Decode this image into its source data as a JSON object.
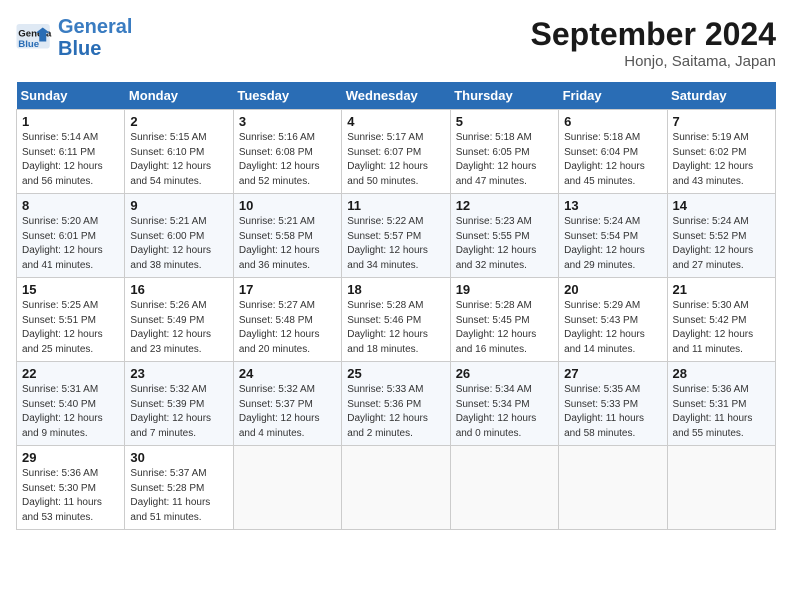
{
  "header": {
    "logo_line1": "General",
    "logo_line2": "Blue",
    "month_title": "September 2024",
    "location": "Honjo, Saitama, Japan"
  },
  "days_of_week": [
    "Sunday",
    "Monday",
    "Tuesday",
    "Wednesday",
    "Thursday",
    "Friday",
    "Saturday"
  ],
  "weeks": [
    [
      {
        "day": "1",
        "info": "Sunrise: 5:14 AM\nSunset: 6:11 PM\nDaylight: 12 hours\nand 56 minutes."
      },
      {
        "day": "2",
        "info": "Sunrise: 5:15 AM\nSunset: 6:10 PM\nDaylight: 12 hours\nand 54 minutes."
      },
      {
        "day": "3",
        "info": "Sunrise: 5:16 AM\nSunset: 6:08 PM\nDaylight: 12 hours\nand 52 minutes."
      },
      {
        "day": "4",
        "info": "Sunrise: 5:17 AM\nSunset: 6:07 PM\nDaylight: 12 hours\nand 50 minutes."
      },
      {
        "day": "5",
        "info": "Sunrise: 5:18 AM\nSunset: 6:05 PM\nDaylight: 12 hours\nand 47 minutes."
      },
      {
        "day": "6",
        "info": "Sunrise: 5:18 AM\nSunset: 6:04 PM\nDaylight: 12 hours\nand 45 minutes."
      },
      {
        "day": "7",
        "info": "Sunrise: 5:19 AM\nSunset: 6:02 PM\nDaylight: 12 hours\nand 43 minutes."
      }
    ],
    [
      {
        "day": "8",
        "info": "Sunrise: 5:20 AM\nSunset: 6:01 PM\nDaylight: 12 hours\nand 41 minutes."
      },
      {
        "day": "9",
        "info": "Sunrise: 5:21 AM\nSunset: 6:00 PM\nDaylight: 12 hours\nand 38 minutes."
      },
      {
        "day": "10",
        "info": "Sunrise: 5:21 AM\nSunset: 5:58 PM\nDaylight: 12 hours\nand 36 minutes."
      },
      {
        "day": "11",
        "info": "Sunrise: 5:22 AM\nSunset: 5:57 PM\nDaylight: 12 hours\nand 34 minutes."
      },
      {
        "day": "12",
        "info": "Sunrise: 5:23 AM\nSunset: 5:55 PM\nDaylight: 12 hours\nand 32 minutes."
      },
      {
        "day": "13",
        "info": "Sunrise: 5:24 AM\nSunset: 5:54 PM\nDaylight: 12 hours\nand 29 minutes."
      },
      {
        "day": "14",
        "info": "Sunrise: 5:24 AM\nSunset: 5:52 PM\nDaylight: 12 hours\nand 27 minutes."
      }
    ],
    [
      {
        "day": "15",
        "info": "Sunrise: 5:25 AM\nSunset: 5:51 PM\nDaylight: 12 hours\nand 25 minutes."
      },
      {
        "day": "16",
        "info": "Sunrise: 5:26 AM\nSunset: 5:49 PM\nDaylight: 12 hours\nand 23 minutes."
      },
      {
        "day": "17",
        "info": "Sunrise: 5:27 AM\nSunset: 5:48 PM\nDaylight: 12 hours\nand 20 minutes."
      },
      {
        "day": "18",
        "info": "Sunrise: 5:28 AM\nSunset: 5:46 PM\nDaylight: 12 hours\nand 18 minutes."
      },
      {
        "day": "19",
        "info": "Sunrise: 5:28 AM\nSunset: 5:45 PM\nDaylight: 12 hours\nand 16 minutes."
      },
      {
        "day": "20",
        "info": "Sunrise: 5:29 AM\nSunset: 5:43 PM\nDaylight: 12 hours\nand 14 minutes."
      },
      {
        "day": "21",
        "info": "Sunrise: 5:30 AM\nSunset: 5:42 PM\nDaylight: 12 hours\nand 11 minutes."
      }
    ],
    [
      {
        "day": "22",
        "info": "Sunrise: 5:31 AM\nSunset: 5:40 PM\nDaylight: 12 hours\nand 9 minutes."
      },
      {
        "day": "23",
        "info": "Sunrise: 5:32 AM\nSunset: 5:39 PM\nDaylight: 12 hours\nand 7 minutes."
      },
      {
        "day": "24",
        "info": "Sunrise: 5:32 AM\nSunset: 5:37 PM\nDaylight: 12 hours\nand 4 minutes."
      },
      {
        "day": "25",
        "info": "Sunrise: 5:33 AM\nSunset: 5:36 PM\nDaylight: 12 hours\nand 2 minutes."
      },
      {
        "day": "26",
        "info": "Sunrise: 5:34 AM\nSunset: 5:34 PM\nDaylight: 12 hours\nand 0 minutes."
      },
      {
        "day": "27",
        "info": "Sunrise: 5:35 AM\nSunset: 5:33 PM\nDaylight: 11 hours\nand 58 minutes."
      },
      {
        "day": "28",
        "info": "Sunrise: 5:36 AM\nSunset: 5:31 PM\nDaylight: 11 hours\nand 55 minutes."
      }
    ],
    [
      {
        "day": "29",
        "info": "Sunrise: 5:36 AM\nSunset: 5:30 PM\nDaylight: 11 hours\nand 53 minutes."
      },
      {
        "day": "30",
        "info": "Sunrise: 5:37 AM\nSunset: 5:28 PM\nDaylight: 11 hours\nand 51 minutes."
      },
      {
        "day": "",
        "info": ""
      },
      {
        "day": "",
        "info": ""
      },
      {
        "day": "",
        "info": ""
      },
      {
        "day": "",
        "info": ""
      },
      {
        "day": "",
        "info": ""
      }
    ]
  ]
}
